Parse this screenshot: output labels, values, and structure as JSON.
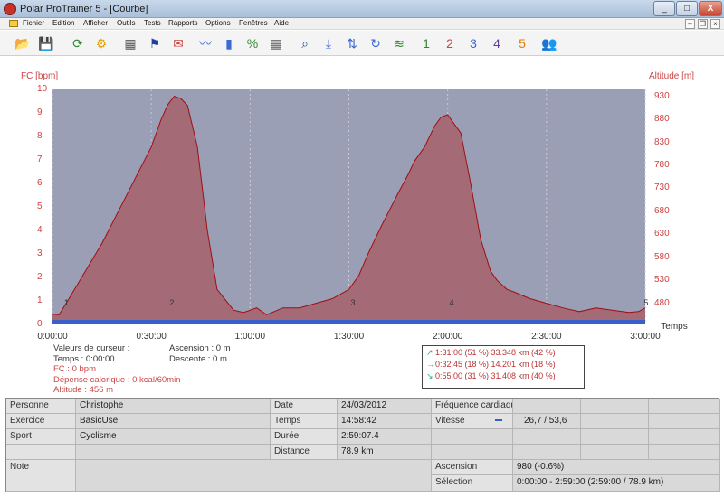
{
  "window": {
    "title": "Polar ProTrainer 5 - [Courbe]",
    "btn_min": "_",
    "btn_max": "□",
    "btn_close": "X"
  },
  "menu": [
    "Fichier",
    "Edition",
    "Afficher",
    "Outils",
    "Tests",
    "Rapports",
    "Options",
    "Fenêtres",
    "Aide"
  ],
  "mdi": {
    "min": "–",
    "restore": "❐",
    "close": "×"
  },
  "toolbar": {
    "icons": [
      {
        "name": "open-folder-icon",
        "glyph": "📂",
        "color": "#e6a400"
      },
      {
        "name": "save-icon",
        "glyph": "💾",
        "color": "#2a4f8a"
      },
      {
        "name": "sync-watch-icon",
        "glyph": "⟳",
        "color": "#2d8a2d"
      },
      {
        "name": "watch-settings-icon",
        "glyph": "⚙",
        "color": "#e6a400"
      },
      {
        "name": "calendar-icon",
        "glyph": "▦",
        "color": "#555"
      },
      {
        "name": "flag-icon",
        "glyph": "⚑",
        "color": "#1a3f9e"
      },
      {
        "name": "user-message-icon",
        "glyph": "✉",
        "color": "#c44"
      },
      {
        "name": "curve-view-icon",
        "glyph": "〰",
        "color": "#3a6ad6"
      },
      {
        "name": "bar-chart-icon",
        "glyph": "▮",
        "color": "#3a6ad6"
      },
      {
        "name": "percent-chart-icon",
        "glyph": "%",
        "color": "#3a8a3a"
      },
      {
        "name": "grid-view-icon",
        "glyph": "▦",
        "color": "#666"
      },
      {
        "name": "zoom-icon",
        "glyph": "⌕",
        "color": "#2a4f8a"
      },
      {
        "name": "download-icon",
        "glyph": "⤓",
        "color": "#3a6ad6"
      },
      {
        "name": "transfer-icon",
        "glyph": "⇅",
        "color": "#3a6ad6"
      },
      {
        "name": "rotate-icon",
        "glyph": "↻",
        "color": "#3a6ad6"
      },
      {
        "name": "multi-curve-icon",
        "glyph": "≋",
        "color": "#2d8a2d"
      },
      {
        "name": "exercise-1-icon",
        "glyph": "1",
        "color": "#2d8a2d"
      },
      {
        "name": "exercise-2-icon",
        "glyph": "2",
        "color": "#c44"
      },
      {
        "name": "exercise-3-icon",
        "glyph": "3",
        "color": "#3a6ad6"
      },
      {
        "name": "exercise-4-icon",
        "glyph": "4",
        "color": "#6a3a9a"
      },
      {
        "name": "exercise-5-icon",
        "glyph": "5",
        "color": "#e67a00"
      },
      {
        "name": "users-icon",
        "glyph": "👥",
        "color": "#c44"
      }
    ]
  },
  "chart_data": {
    "type": "area",
    "ylabel_left": "FC [bpm]",
    "ylabel_right": "Altitude [m]",
    "xlabel": "Temps",
    "y_left_ticks": [
      "0",
      "1",
      "2",
      "3",
      "4",
      "5",
      "6",
      "7",
      "8",
      "9",
      "10"
    ],
    "y_right_ticks": [
      "480",
      "530",
      "580",
      "630",
      "680",
      "730",
      "780",
      "830",
      "880",
      "930"
    ],
    "x_ticks": [
      "0:00:00",
      "0:30:00",
      "1:00:00",
      "1:30:00",
      "2:00:00",
      "2:30:00",
      "3:00:00"
    ],
    "x_range_minutes": [
      0,
      180
    ],
    "y_right_range": [
      434,
      945
    ],
    "lap_labels": [
      "1",
      "2",
      "3",
      "4",
      "5"
    ],
    "lap_times_minutes": [
      3,
      35,
      90,
      120,
      179
    ],
    "series": [
      {
        "name": "Altitude [m]",
        "x_minutes": [
          0,
          2,
          5,
          10,
          15,
          20,
          25,
          30,
          33,
          35,
          37,
          39,
          41,
          44,
          47,
          50,
          55,
          58,
          62,
          65,
          70,
          75,
          80,
          85,
          90,
          93,
          96,
          100,
          105,
          108,
          110,
          113,
          116,
          118,
          120,
          122,
          124,
          127,
          130,
          133,
          135,
          138,
          140,
          145,
          150,
          155,
          160,
          165,
          170,
          175,
          178,
          180
        ],
        "values": [
          456,
          455,
          490,
          550,
          610,
          680,
          750,
          820,
          880,
          912,
          930,
          925,
          910,
          820,
          640,
          510,
          465,
          460,
          470,
          455,
          470,
          470,
          480,
          490,
          510,
          540,
          590,
          650,
          720,
          760,
          790,
          820,
          865,
          885,
          890,
          870,
          850,
          740,
          620,
          550,
          530,
          510,
          505,
          490,
          480,
          470,
          462,
          470,
          465,
          460,
          462,
          470
        ]
      }
    ],
    "colors": {
      "background": "#9b9fb6",
      "fill": "#a46a76",
      "line": "#a10d12",
      "baseline": "#3a5fc9"
    }
  },
  "cursor_info": {
    "left": [
      "Valeurs de curseur :",
      "Temps : 0:00:00",
      "FC : 0 bpm",
      "Dépense calorique : 0 kcal/60min",
      "Altitude : 456 m"
    ],
    "right": [
      "Ascension : 0 m",
      "Descente : 0 m"
    ]
  },
  "selection_box": [
    {
      "arrow": "↗",
      "text": "1:31:00  (51 %)  33.348 km  (42 %)"
    },
    {
      "arrow": "→",
      "text": "0:32:45  (18 %)  14.201 km  (18 %)"
    },
    {
      "arrow": "↘",
      "text": "0:55:00  (31 %)  31.408 km  (40 %)"
    }
  ],
  "table": {
    "personne_label": "Personne",
    "personne_value": "Christophe",
    "exercice_label": "Exercice",
    "exercice_value": "BasicUse",
    "sport_label": "Sport",
    "sport_value": "Cyclisme",
    "note_label": "Note",
    "date_label": "Date",
    "date_value": "24/03/2012",
    "temps_label": "Temps",
    "temps_value": "14:58:42",
    "duree_label": "Durée",
    "duree_value": "2:59:07.4",
    "distance_label": "Distance",
    "distance_value": "78.9 km",
    "freq_label": "Fréquence cardiaque",
    "vitesse_label": "Vitesse",
    "vitesse_value": "26,7 / 53,6",
    "ascension_label": "Ascension",
    "ascension_value": "980 (-0.6%)",
    "selection_label": "Sélection",
    "selection_value": "0:00:00 - 2:59:00 (2:59:00 / 78.9 km)"
  }
}
